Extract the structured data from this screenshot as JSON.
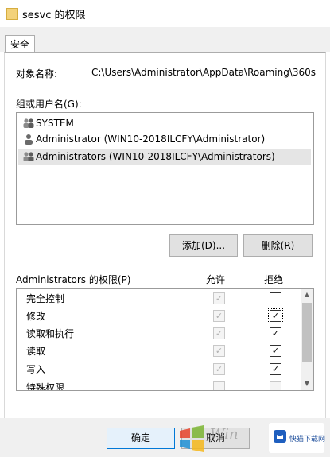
{
  "window": {
    "title": "sesvc 的权限"
  },
  "tabs": [
    {
      "label": "安全"
    }
  ],
  "object": {
    "label": "对象名称:",
    "value": "C:\\Users\\Administrator\\AppData\\Roaming\\360s"
  },
  "groups": {
    "label": "组或用户名(G):",
    "items": [
      {
        "name": "SYSTEM",
        "icon": "users-group-icon"
      },
      {
        "name": "Administrator (WIN10-2018ILCFY\\Administrator)",
        "icon": "user-icon"
      },
      {
        "name": "Administrators (WIN10-2018ILCFY\\Administrators)",
        "icon": "users-group-icon",
        "selected": true
      }
    ]
  },
  "buttons": {
    "add": "添加(D)...",
    "remove": "删除(R)",
    "ok": "确定",
    "cancel": "取消"
  },
  "permissions": {
    "label": "Administrators 的权限(P)",
    "allow_header": "允许",
    "deny_header": "拒绝",
    "rows": [
      {
        "name": "完全控制",
        "allow": true,
        "allow_disabled": true,
        "deny": false
      },
      {
        "name": "修改",
        "allow": true,
        "allow_disabled": true,
        "deny": true
      },
      {
        "name": "读取和执行",
        "allow": true,
        "allow_disabled": true,
        "deny": true
      },
      {
        "name": "读取",
        "allow": true,
        "allow_disabled": true,
        "deny": true
      },
      {
        "name": "写入",
        "allow": true,
        "allow_disabled": true,
        "deny": true
      },
      {
        "name": "特殊权限",
        "allow": false,
        "allow_disabled": true,
        "deny": false,
        "deny_disabled": true
      }
    ]
  },
  "watermark": {
    "text": "Win7系统之家",
    "url_text": "www.Winwin7.com"
  },
  "badge": {
    "text": "快猫下载网"
  }
}
